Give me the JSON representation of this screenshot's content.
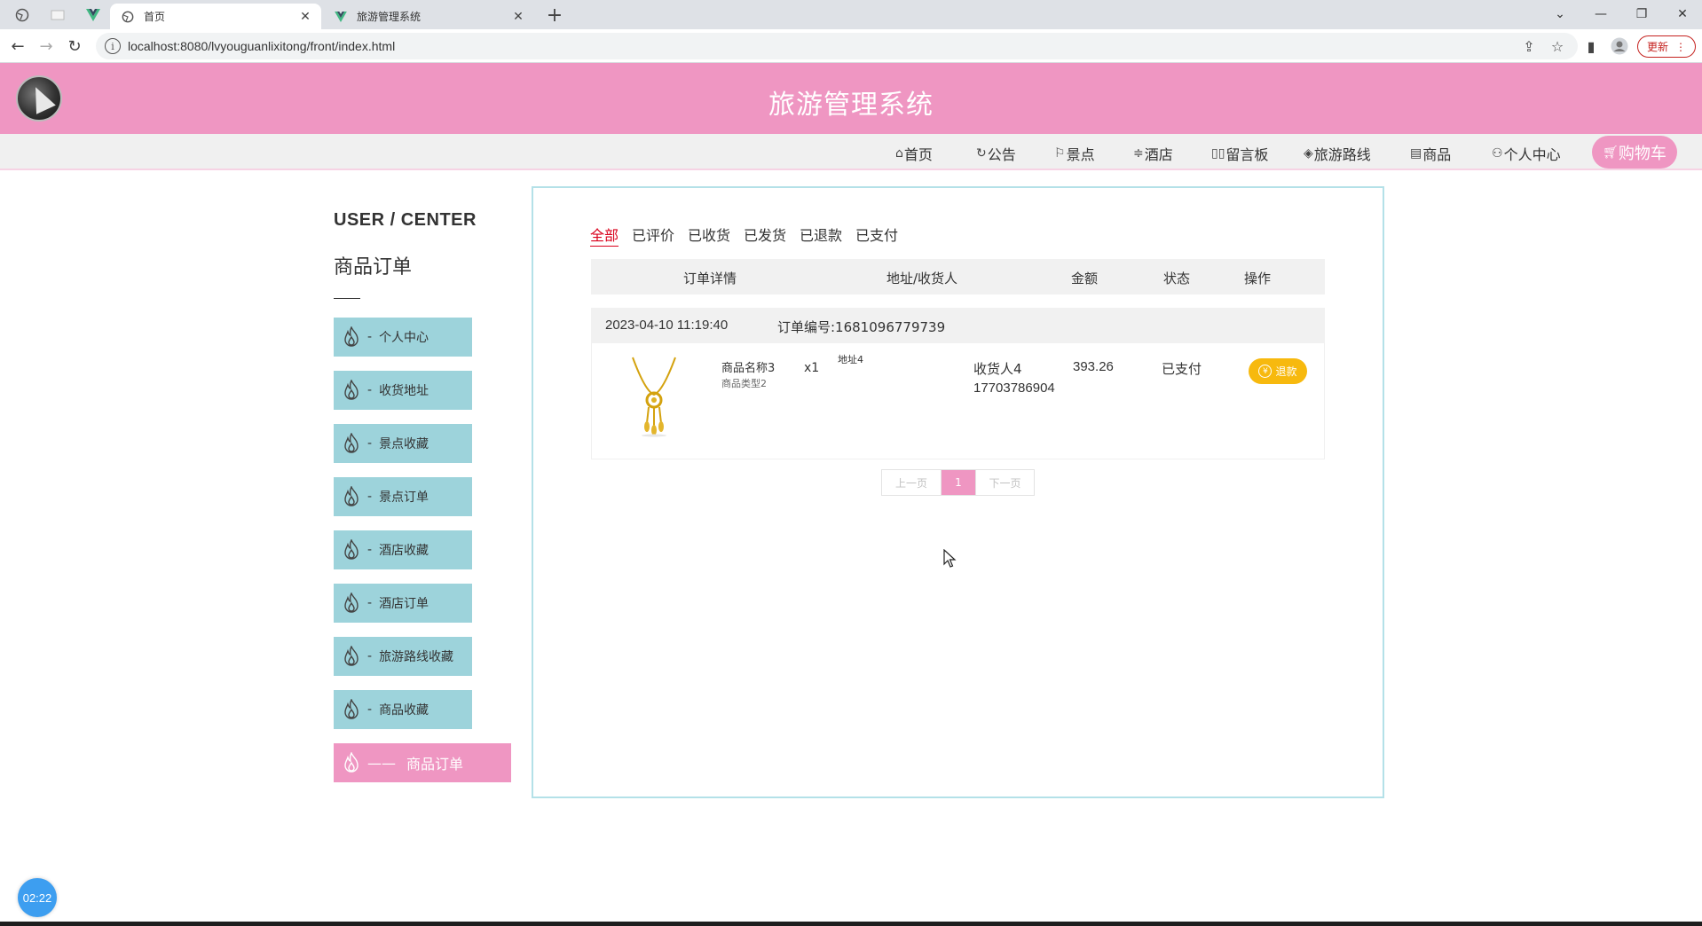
{
  "browser": {
    "tabs": [
      {
        "title": "首页"
      },
      {
        "title": "旅游管理系统"
      }
    ],
    "url": "localhost:8080/lvyouguanlixitong/front/index.html",
    "update_label": "更新"
  },
  "header": {
    "title": "旅游管理系统"
  },
  "nav": {
    "items": [
      {
        "label": "首页",
        "icon": "home-icon"
      },
      {
        "label": "公告",
        "icon": "refresh-icon"
      },
      {
        "label": "景点",
        "icon": "flag-icon"
      },
      {
        "label": "酒店",
        "icon": "sliders-icon"
      },
      {
        "label": "留言板",
        "icon": "book-icon"
      },
      {
        "label": "旅游路线",
        "icon": "graduation-cap-icon"
      },
      {
        "label": "商品",
        "icon": "document-icon"
      },
      {
        "label": "个人中心",
        "icon": "user-icon"
      }
    ],
    "cart_label": "购物车"
  },
  "sidebar": {
    "title": "USER / CENTER",
    "heading": "商品订单",
    "items": [
      {
        "label": "个人中心"
      },
      {
        "label": "收货地址"
      },
      {
        "label": "景点收藏"
      },
      {
        "label": "景点订单"
      },
      {
        "label": "酒店收藏"
      },
      {
        "label": "酒店订单"
      },
      {
        "label": "旅游路线收藏"
      },
      {
        "label": "商品收藏"
      },
      {
        "label": "商品订单",
        "active": true
      }
    ]
  },
  "orders": {
    "status_tabs": [
      "全部",
      "已评价",
      "已收货",
      "已发货",
      "已退款",
      "已支付"
    ],
    "active_tab": "全部",
    "columns": [
      "订单详情",
      "地址/收货人",
      "金额",
      "状态",
      "操作"
    ],
    "list": [
      {
        "date": "2023-04-10 11:19:40",
        "order_no": "订单编号:1681096779739",
        "product_name": "商品名称3",
        "product_type": "商品类型2",
        "quantity": "x1",
        "address": "地址4",
        "receiver": "收货人4",
        "phone": "17703786904",
        "amount": "393.26",
        "status": "已支付",
        "action": "退款"
      }
    ],
    "pager": {
      "prev": "上一页",
      "current": "1",
      "next": "下一页"
    }
  },
  "timer": "02:22",
  "colors": {
    "brand_pink": "#ef96c2",
    "sidebar_teal": "#9dd3db",
    "refund_yellow": "#f7b90e",
    "active_red": "#d9001b"
  }
}
